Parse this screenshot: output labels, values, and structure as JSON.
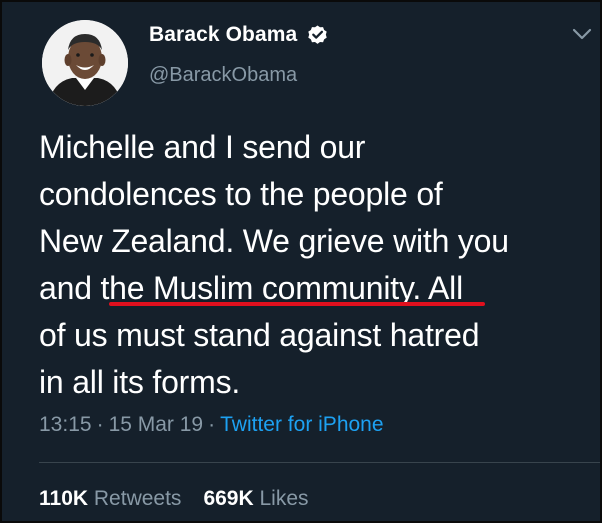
{
  "author": {
    "display_name": "Barack Obama",
    "handle": "@BarackObama",
    "verified": true
  },
  "tweet": {
    "text": "Michelle and I send our\ncondolences to the people of\nNew Zealand. We grieve with you\nand the Muslim community. All\nof us must stand against hatred\nin all its forms.",
    "highlighted_phrase": "the Muslim community.",
    "highlight_color": "#e0101e",
    "time": "13:15",
    "separator": "·",
    "date": "15 Mar 19",
    "source": "Twitter for iPhone"
  },
  "stats": {
    "retweets_count": "110K",
    "retweets_label": "Retweets",
    "likes_count": "669K",
    "likes_label": "Likes"
  },
  "icons": {
    "verified": "verified-badge-icon",
    "menu": "chevron-down-icon"
  },
  "colors": {
    "background": "#15202b",
    "text": "#ffffff",
    "secondary": "#8899a6",
    "link": "#1da1f2"
  }
}
